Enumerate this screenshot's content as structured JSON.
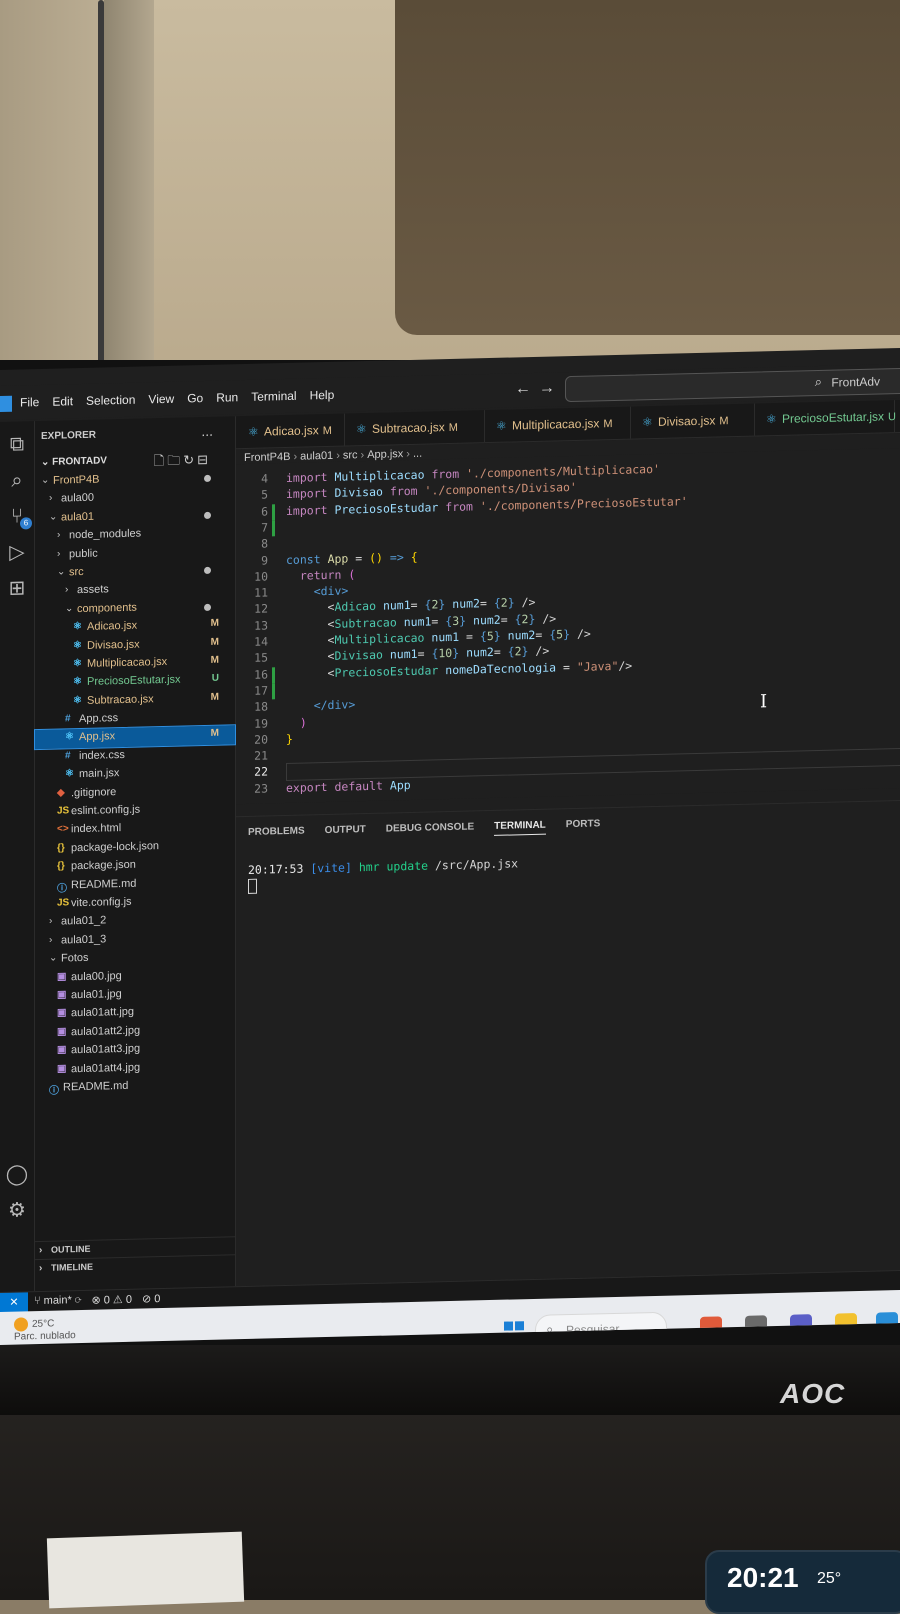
{
  "menu": [
    "File",
    "Edit",
    "Selection",
    "View",
    "Go",
    "Run",
    "Terminal",
    "Help"
  ],
  "search": {
    "text": "FrontAdv"
  },
  "explorer": {
    "title": "EXPLORER",
    "more": "...",
    "root": "FRONTADV",
    "tree": [
      {
        "name": "FrontP4B",
        "indent": 0,
        "chev": "v",
        "color": "modified",
        "dot": true
      },
      {
        "name": "aula00",
        "indent": 1,
        "chev": ">"
      },
      {
        "name": "aula01",
        "indent": 1,
        "chev": "v",
        "color": "modified",
        "dot": true
      },
      {
        "name": "node_modules",
        "indent": 2,
        "chev": ">"
      },
      {
        "name": "public",
        "indent": 2,
        "chev": ">"
      },
      {
        "name": "src",
        "indent": 2,
        "chev": "v",
        "color": "modified",
        "dot": true
      },
      {
        "name": "assets",
        "indent": 3,
        "chev": ">"
      },
      {
        "name": "components",
        "indent": 3,
        "chev": "v",
        "color": "modified",
        "dot": true
      },
      {
        "name": "Adicao.jsx",
        "indent": 4,
        "icon": "react",
        "color": "modified",
        "status": "M"
      },
      {
        "name": "Divisao.jsx",
        "indent": 4,
        "icon": "react",
        "color": "modified",
        "status": "M"
      },
      {
        "name": "Multiplicacao.jsx",
        "indent": 4,
        "icon": "react",
        "color": "modified",
        "status": "M"
      },
      {
        "name": "PreciosoEstutar.jsx",
        "indent": 4,
        "icon": "react",
        "color": "untracked",
        "status": "U"
      },
      {
        "name": "Subtracao.jsx",
        "indent": 4,
        "icon": "react",
        "color": "modified",
        "status": "M"
      },
      {
        "name": "App.css",
        "indent": 3,
        "icon": "hash"
      },
      {
        "name": "App.jsx",
        "indent": 3,
        "icon": "react",
        "color": "modified",
        "status": "M",
        "selected": true
      },
      {
        "name": "index.css",
        "indent": 3,
        "icon": "hash"
      },
      {
        "name": "main.jsx",
        "indent": 3,
        "icon": "react"
      },
      {
        "name": ".gitignore",
        "indent": 2,
        "icon": "git"
      },
      {
        "name": "eslint.config.js",
        "indent": 2,
        "icon": "js"
      },
      {
        "name": "index.html",
        "indent": 2,
        "icon": "html"
      },
      {
        "name": "package-lock.json",
        "indent": 2,
        "icon": "json"
      },
      {
        "name": "package.json",
        "indent": 2,
        "icon": "json"
      },
      {
        "name": "README.md",
        "indent": 2,
        "icon": "info"
      },
      {
        "name": "vite.config.js",
        "indent": 2,
        "icon": "js"
      },
      {
        "name": "aula01_2",
        "indent": 1,
        "chev": ">"
      },
      {
        "name": "aula01_3",
        "indent": 1,
        "chev": ">"
      },
      {
        "name": "Fotos",
        "indent": 1,
        "chev": "v"
      },
      {
        "name": "aula00.jpg",
        "indent": 2,
        "icon": "img"
      },
      {
        "name": "aula01.jpg",
        "indent": 2,
        "icon": "img"
      },
      {
        "name": "aula01att.jpg",
        "indent": 2,
        "icon": "img"
      },
      {
        "name": "aula01att2.jpg",
        "indent": 2,
        "icon": "img"
      },
      {
        "name": "aula01att3.jpg",
        "indent": 2,
        "icon": "img"
      },
      {
        "name": "aula01att4.jpg",
        "indent": 2,
        "icon": "img"
      },
      {
        "name": "README.md",
        "indent": 1,
        "icon": "info"
      }
    ],
    "outline": "OUTLINE",
    "timeline": "TIMELINE"
  },
  "tabs": [
    {
      "name": "Adicao.jsx",
      "status": "M"
    },
    {
      "name": "Subtracao.jsx",
      "status": "M"
    },
    {
      "name": "Multiplicacao.jsx",
      "status": "M"
    },
    {
      "name": "Divisao.jsx",
      "status": "M"
    },
    {
      "name": "PreciosoEstutar.jsx",
      "status": "U"
    }
  ],
  "breadcrumb": [
    "FrontP4B",
    "aula01",
    "src",
    "App.jsx",
    "..."
  ],
  "editor": {
    "lines": [
      {
        "n": "4",
        "html": "<span class='kw'>import</span> <span class='var'>Multiplicacao</span> <span class='kw'>from</span> <span class='str'>'./components/Multiplicacao'</span>"
      },
      {
        "n": "5",
        "html": "<span class='kw'>import</span> <span class='var'>Divisao</span> <span class='kw'>from</span> <span class='str'>'./components/Divisao'</span>"
      },
      {
        "n": "6",
        "html": "<span class='kw'>import</span> <span class='var'>PreciosoEstudar</span> <span class='kw'>from</span> <span class='str'>'./components/PreciosoEstutar'</span>",
        "git": true
      },
      {
        "n": "7",
        "html": "",
        "git": true
      },
      {
        "n": "8",
        "html": ""
      },
      {
        "n": "9",
        "html": "<span class='kw2'>const</span> <span class='fn'>App</span> = <span class='br'>()</span> <span class='kw2'>=&gt;</span> <span class='br'>{</span>"
      },
      {
        "n": "10",
        "html": "  <span class='kw'>return</span> <span class='br2'>(</span>"
      },
      {
        "n": "11",
        "html": "    <span class='kw2'>&lt;div&gt;</span>"
      },
      {
        "n": "12",
        "html": "      &lt;<span class='tag'>Adicao</span> <span class='attr'>num1</span>= <span class='kw2'>{</span><span class='num'>2</span><span class='kw2'>}</span> <span class='attr'>num2</span>= <span class='kw2'>{</span><span class='num'>2</span><span class='kw2'>}</span> /&gt;"
      },
      {
        "n": "13",
        "html": "      &lt;<span class='tag'>Subtracao</span> <span class='attr'>num1</span>= <span class='kw2'>{</span><span class='num'>3</span><span class='kw2'>}</span> <span class='attr'>num2</span>= <span class='kw2'>{</span><span class='num'>2</span><span class='kw2'>}</span> /&gt;"
      },
      {
        "n": "14",
        "html": "      &lt;<span class='tag'>Multiplicacao</span> <span class='attr'>num1</span> = <span class='kw2'>{</span><span class='num'>5</span><span class='kw2'>}</span> <span class='attr'>num2</span>= <span class='kw2'>{</span><span class='num'>5</span><span class='kw2'>}</span> /&gt;"
      },
      {
        "n": "15",
        "html": "      &lt;<span class='tag'>Divisao</span> <span class='attr'>num1</span>= <span class='kw2'>{</span><span class='num'>10</span><span class='kw2'>}</span> <span class='attr'>num2</span>= <span class='kw2'>{</span><span class='num'>2</span><span class='kw2'>}</span> /&gt;"
      },
      {
        "n": "16",
        "html": "      &lt;<span class='tag'>PreciosoEstudar</span> <span class='attr'>nomeDaTecnologia</span> = <span class='str'>\"Java\"</span>/&gt;",
        "git": true
      },
      {
        "n": "17",
        "html": "",
        "git": true
      },
      {
        "n": "18",
        "html": "    <span class='kw2'>&lt;/div&gt;</span>"
      },
      {
        "n": "19",
        "html": "  <span class='br2'>)</span>"
      },
      {
        "n": "20",
        "html": "<span class='br'>}</span>"
      },
      {
        "n": "21",
        "html": ""
      },
      {
        "n": "22",
        "html": "",
        "current": true
      },
      {
        "n": "23",
        "html": "<span class='kw'>export</span> <span class='kw'>default</span> <span class='var'>App</span>"
      }
    ]
  },
  "panel": {
    "tabs": [
      "PROBLEMS",
      "OUTPUT",
      "DEBUG CONSOLE",
      "TERMINAL",
      "PORTS"
    ],
    "active": "TERMINAL",
    "time": "20:17:53",
    "vite": "[vite]",
    "hmr": "hmr update",
    "path": "/src/App.jsx"
  },
  "status": {
    "branch": "main*",
    "errors": "0",
    "warnings": "0",
    "ports": "0"
  },
  "taskbar": {
    "temp": "25°C",
    "weather": "Parc. nublado",
    "search": "Pesquisar"
  },
  "monitor_brand": "AOC",
  "phone": {
    "time": "20:21",
    "temp": "25°"
  }
}
